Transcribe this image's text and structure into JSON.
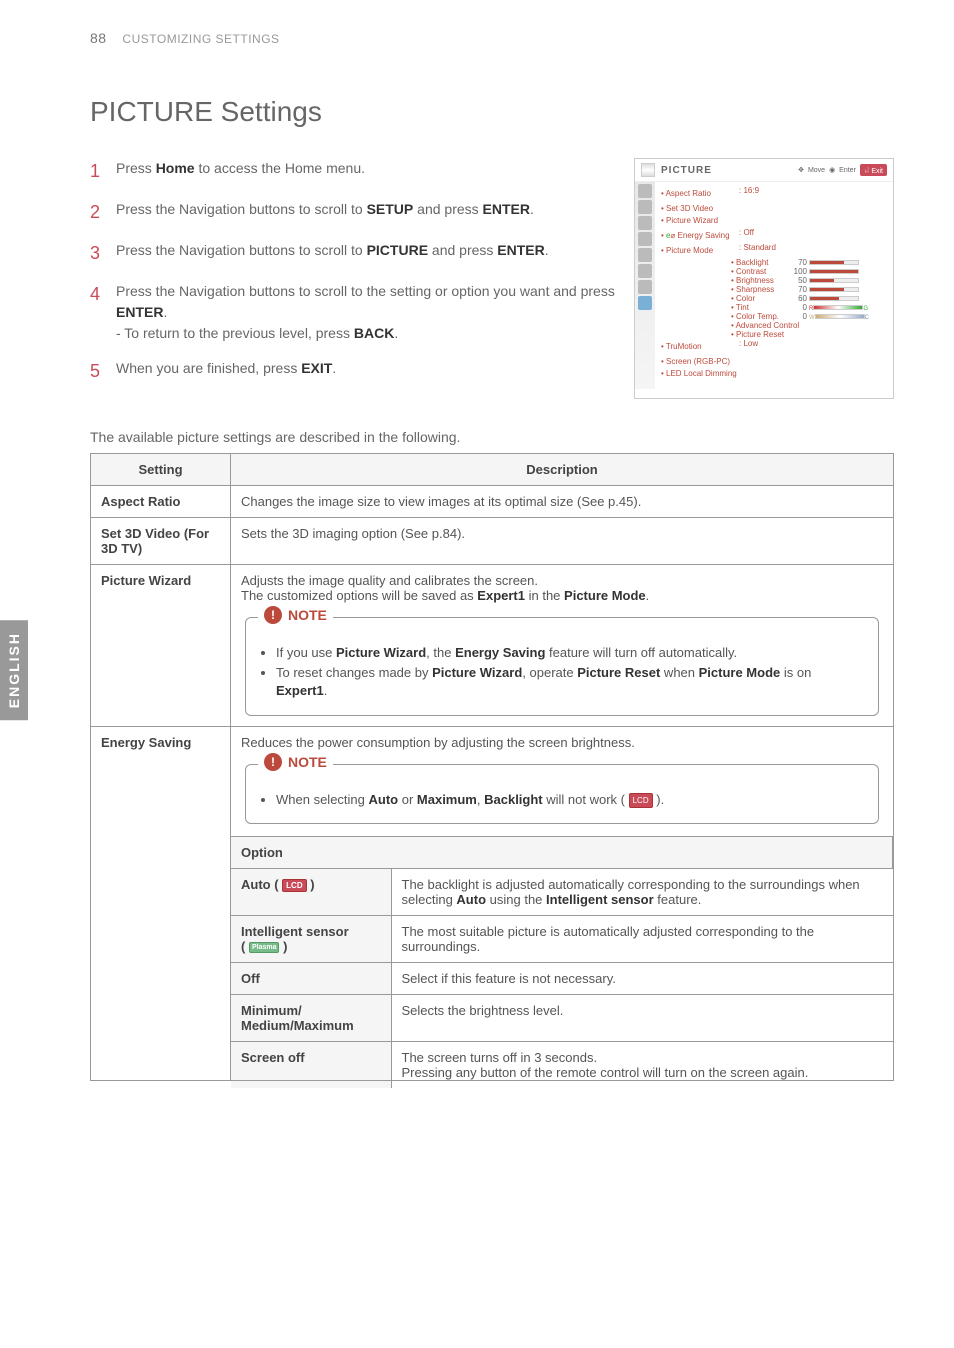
{
  "sidebar": {
    "language": "ENGLISH"
  },
  "header": {
    "page_number": "88",
    "section": "CUSTOMIZING SETTINGS"
  },
  "title": "PICTURE Settings",
  "steps": [
    {
      "num": "1",
      "html": "Press <b>Home</b> to access the Home menu."
    },
    {
      "num": "2",
      "html": "Press the Navigation buttons to scroll to <b>SETUP</b> and press <b>ENTER</b>."
    },
    {
      "num": "3",
      "html": "Press the Navigation buttons to scroll to <b>PICTURE</b> and press <b>ENTER</b>."
    },
    {
      "num": "4",
      "html": "Press the Navigation buttons to scroll to the setting or option you want and press <b>ENTER</b>.<br>- To return to the previous level, press <b>BACK</b>."
    },
    {
      "num": "5",
      "html": "When you are finished, press <b>EXIT</b>."
    }
  ],
  "menu": {
    "title": "PICTURE",
    "move": "Move",
    "enter": "Enter",
    "exit": "Exit",
    "items": {
      "aspect_ratio": {
        "label": "• Aspect Ratio",
        "value": ": 16:9"
      },
      "set3d": "• Set 3D Video",
      "picture_wizard": "• Picture Wizard",
      "energy_saving": {
        "label_prefix": "• ",
        "eco": "e",
        "label_suffix": " Energy Saving",
        "value": ": Off"
      },
      "picture_mode": {
        "label": "• Picture Mode",
        "value": ": Standard"
      },
      "sliders": [
        {
          "label": "• Backlight",
          "value": "70",
          "fill": 70
        },
        {
          "label": "• Contrast",
          "value": "100",
          "fill": 100
        },
        {
          "label": "• Brightness",
          "value": "50",
          "fill": 50
        },
        {
          "label": "• Sharpness",
          "value": "70",
          "fill": 70
        },
        {
          "label": "• Color",
          "value": "60",
          "fill": 60
        }
      ],
      "tint": {
        "label": "• Tint",
        "value": "0",
        "left": "R",
        "right": "G"
      },
      "color_temp": {
        "label": "• Color Temp.",
        "value": "0",
        "left": "W",
        "right": "C"
      },
      "adv": "• Advanced Control",
      "preset": "• Picture Reset",
      "trumotion": {
        "label": "• TruMotion",
        "value": ": Low"
      },
      "screen": "• Screen (RGB-PC)",
      "led": "• LED Local Dimming"
    }
  },
  "intro": "The available picture settings are described in the following.",
  "table": {
    "headers": {
      "setting": "Setting",
      "description": "Description"
    },
    "rows": {
      "aspect": {
        "name": "Aspect Ratio",
        "desc": "Changes the image size to view images at its optimal size (See p.45)."
      },
      "set3d": {
        "name": "Set 3D Video (For 3D TV)",
        "desc": "Sets the 3D imaging option (See p.84)."
      },
      "picwiz": {
        "name": "Picture Wizard",
        "desc_html": "Adjusts the image quality and calibrates the screen.<br>The customized options will be saved as <b>Expert1</b> in the <b>Picture Mode</b>.",
        "note_label": "NOTE",
        "note_items": [
          "If you use <b>Picture Wizard</b>, the <b>Energy Saving</b> feature will turn off automatically.",
          "To reset changes made by <b>Picture Wizard</b>, operate <b>Picture Reset</b> when <b>Picture Mode</b> is on <b>Expert1</b>."
        ]
      },
      "energy": {
        "name": "Energy Saving",
        "desc": "Reduces the power consumption by adjusting the screen brightness.",
        "note_label": "NOTE",
        "note_item_html": "When selecting <b>Auto</b> or <b>Maximum</b>, <b>Backlight</b> will not work (",
        "note_item_suffix": ").",
        "option_header": "Option",
        "options": [
          {
            "name_html": "Auto ( <span class='icon-lcd'>LCD</span> )",
            "desc_html": "The backlight is adjusted automatically corresponding to the surroundings when selecting <b>Auto</b> using the <b>Intelligent sensor</b> feature."
          },
          {
            "name_html": "Intelligent sensor<br>( <span class='icon-plasma'>Plasma</span> )",
            "desc": "The most suitable picture is automatically adjusted corresponding to the surroundings."
          },
          {
            "name": "Off",
            "desc": "Select if this feature is not necessary."
          },
          {
            "name": "Minimum/ Medium/Maximum",
            "desc": "Selects the brightness level."
          },
          {
            "name": "Screen off",
            "desc": "The screen turns off in 3 seconds.\nPressing any button of the remote control will turn on the screen again."
          }
        ]
      }
    }
  },
  "icons": {
    "lcd": "LCD"
  }
}
